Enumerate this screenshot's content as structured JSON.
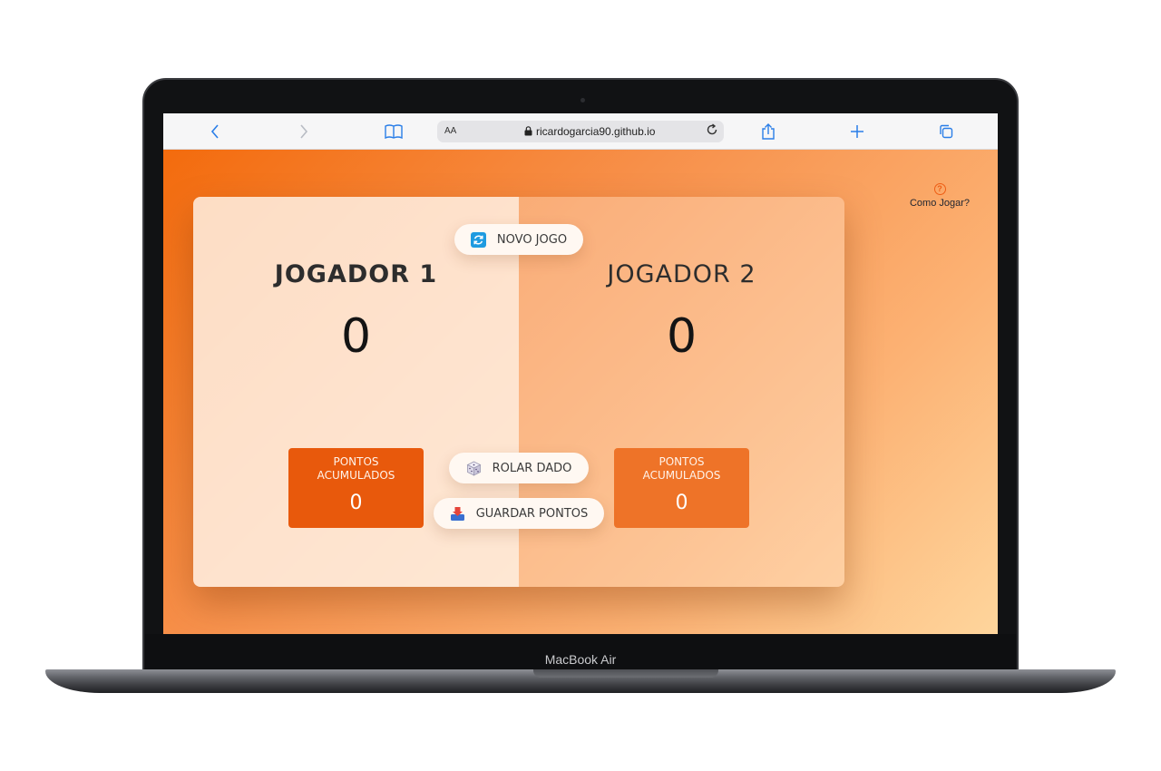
{
  "browser": {
    "url": "ricardogarcia90.github.io",
    "aa_label": "AA",
    "toolbar_icons": [
      "back-icon",
      "forward-icon",
      "bookmarks-icon",
      "lock-icon",
      "reload-icon",
      "share-icon",
      "new-tab-icon",
      "tabs-icon"
    ]
  },
  "page": {
    "help_label": "Como Jogar?",
    "buttons": {
      "new_game": "NOVO JOGO",
      "roll_dice": "ROLAR DADO",
      "hold": "GUARDAR PONTOS"
    },
    "players": [
      {
        "name": "JOGADOR 1",
        "score": "0",
        "current_label": "PONTOS ACUMULADOS",
        "current_score": "0"
      },
      {
        "name": "JOGADOR 2",
        "score": "0",
        "current_label": "PONTOS ACUMULADOS",
        "current_score": "0"
      }
    ]
  },
  "device": {
    "model_label": "MacBook Air"
  },
  "colors": {
    "accent": "#ee5d14",
    "gradient_start": "#f36b0d",
    "gradient_end": "#fed59c",
    "current_box_active": "#e8590c",
    "current_box_inactive": "#ee7328",
    "browser_blue": "#2a7ee8"
  }
}
